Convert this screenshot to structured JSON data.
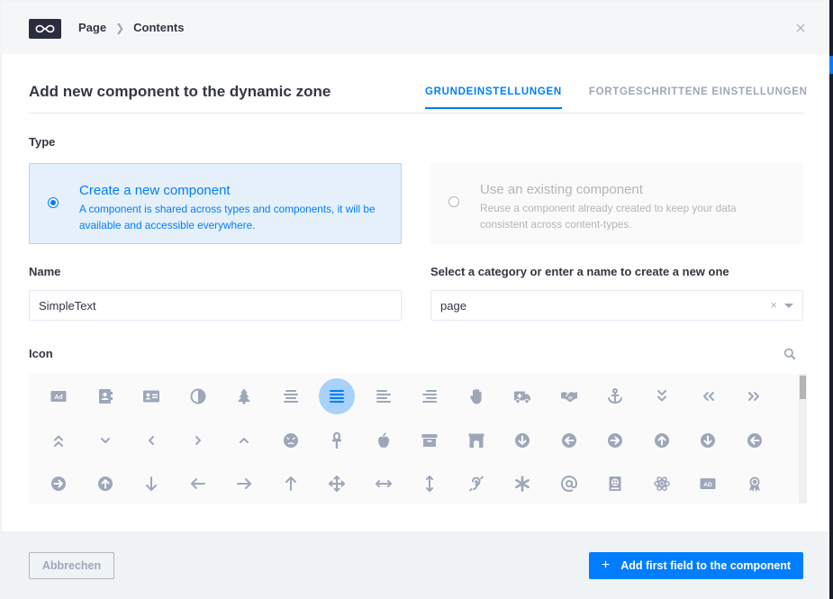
{
  "breadcrumb": {
    "items": [
      "Page",
      "Contents"
    ]
  },
  "header": {
    "title": "Add new component to the dynamic zone"
  },
  "tabs": [
    {
      "label": "GRUNDEINSTELLUNGEN",
      "active": true
    },
    {
      "label": "FORTGESCHRITTENE EINSTELLUNGEN",
      "active": false
    }
  ],
  "type": {
    "label": "Type",
    "options": [
      {
        "title": "Create a new component",
        "desc": "A component is shared across types and components, it will be available and accessible everywhere.",
        "selected": true
      },
      {
        "title": "Use an existing component",
        "desc": "Reuse a component already created to keep your data consistent across content-types.",
        "selected": false
      }
    ]
  },
  "name": {
    "label": "Name",
    "value": "SimpleText"
  },
  "category": {
    "label": "Select a category or enter a name to create a new one",
    "value": "page",
    "clear": "×"
  },
  "icon_picker": {
    "label": "Icon",
    "selected": "align-justify",
    "icons": [
      [
        "ad",
        "address-book",
        "address-card",
        "adjust",
        "tree",
        "align-center",
        "align-justify",
        "align-left",
        "align-right",
        "hand-paper",
        "ambulance",
        "handshake",
        "anchor",
        "angle-double-down",
        "angle-double-left",
        "angle-double-right"
      ],
      [
        "angle-double-up",
        "angle-down",
        "angle-left",
        "angle-right",
        "angle-up",
        "angry",
        "ankh",
        "apple",
        "archive",
        "archway",
        "arrow-circle-down",
        "arrow-circle-left",
        "arrow-circle-right",
        "arrow-circle-up",
        "arrow-circle-down-2",
        "arrow-circle-left-2"
      ],
      [
        "arrow-circle-right-2",
        "arrow-circle-up-2",
        "arrow-down",
        "arrow-left",
        "arrow-right",
        "arrow-up",
        "arrows",
        "arrows-h",
        "arrows-v",
        "deaf",
        "asterisk",
        "at",
        "atlas",
        "atom",
        "audio-description",
        "award"
      ]
    ]
  },
  "footer": {
    "cancel": "Abbrechen",
    "add": "Add first field to the component",
    "add_plus": "+"
  },
  "colors": {
    "accent": "#007eff",
    "selected_bg": "#e6f0fb",
    "icon_gray": "#9ea7b8"
  }
}
